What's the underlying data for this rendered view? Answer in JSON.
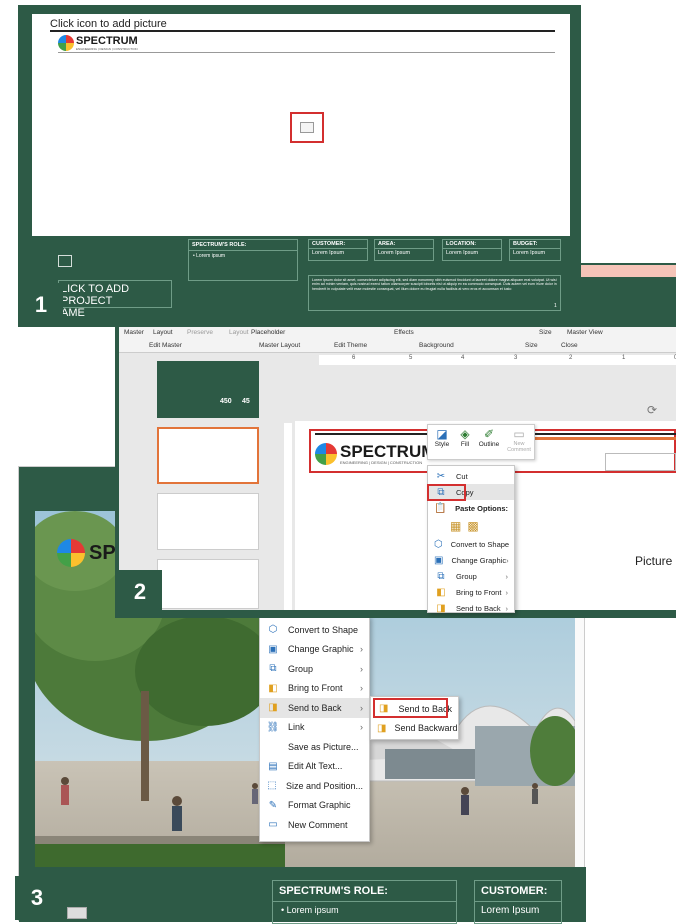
{
  "panel1": {
    "number": "1",
    "placeholder_text": "Click icon to add picture",
    "brand": "SPECTRUM",
    "brand_sub": "ENGINEERING | DESIGN | CONSTRUCTION",
    "project_name_line1": "LICK TO ADD PROJECT",
    "project_name_line2": "AME",
    "role_header": "SPECTRUM'S ROLE:",
    "role_bullet": "Lorem ipsum",
    "fields": [
      {
        "label": "CUSTOMER:",
        "value": "Lorem Ipsum"
      },
      {
        "label": "AREA:",
        "value": "Lorem Ipsum"
      },
      {
        "label": "LOCATION:",
        "value": "Lorem Ipsum"
      },
      {
        "label": "BUDGET:",
        "value": "Lorem Ipsum"
      }
    ],
    "body_text": "Lorem ipsum dolor sit amet, consectetuer adipiscing elit, sed diam nonummy nibh euismod tincidunt ut laoreet dolore magna aliquam erat volutpat. Ut wisi enim ad minim veniam, quis nostrud exerci tation ullamcorper suscipit lobortis nisl ut aliquip ex ea commodo consequat. Duis autem vel eum iriure dolor in hendrerit in vulputate velit esse molestie consequat, vel illum dolore eu feugiat nulla facilisis at vero eros et accumsan et iusto",
    "page_num": "1"
  },
  "panel2": {
    "number": "2",
    "ribbon": {
      "master": "Master",
      "layout": "Layout",
      "preserve": "Preserve",
      "layout2": "Layout",
      "placeholder": "Placeholder",
      "effects": "Effects",
      "size": "Size",
      "master_view": "Master View",
      "groups": [
        "Edit Master",
        "Master Layout",
        "Edit Theme",
        "Background",
        "Size",
        "Close"
      ]
    },
    "ruler": [
      "6",
      "5",
      "4",
      "3",
      "2",
      "1",
      "0"
    ],
    "brand": "SPECTRUM",
    "brand_sub": "ENGINEERING | DESIGN | CONSTRUCTION",
    "toolbar": [
      {
        "label": "Style"
      },
      {
        "label": "Fill"
      },
      {
        "label": "Outline"
      },
      {
        "label": "New Comment"
      }
    ],
    "menu": [
      "Cut",
      "Copy",
      "Paste Options:",
      "Convert to Shape",
      "Change Graphic",
      "Group",
      "Bring to Front",
      "Send to Back"
    ],
    "picture_label": "Picture",
    "thumb_nums": [
      "450",
      "45"
    ]
  },
  "panel3": {
    "number": "3",
    "menu": [
      "Convert to Shape",
      "Change Graphic",
      "Group",
      "Bring to Front",
      "Send to Back",
      "Link",
      "Save as Picture...",
      "Edit Alt Text...",
      "Size and Position...",
      "Format Graphic",
      "New Comment"
    ],
    "submenu": [
      "Send to Back",
      "Send Backward"
    ],
    "role_header": "SPECTRUM'S ROLE:",
    "role_bullet": "Lorem ipsum",
    "customer_header": "CUSTOMER:",
    "customer_value": "Lorem Ipsum",
    "brand_partial": "SP"
  }
}
